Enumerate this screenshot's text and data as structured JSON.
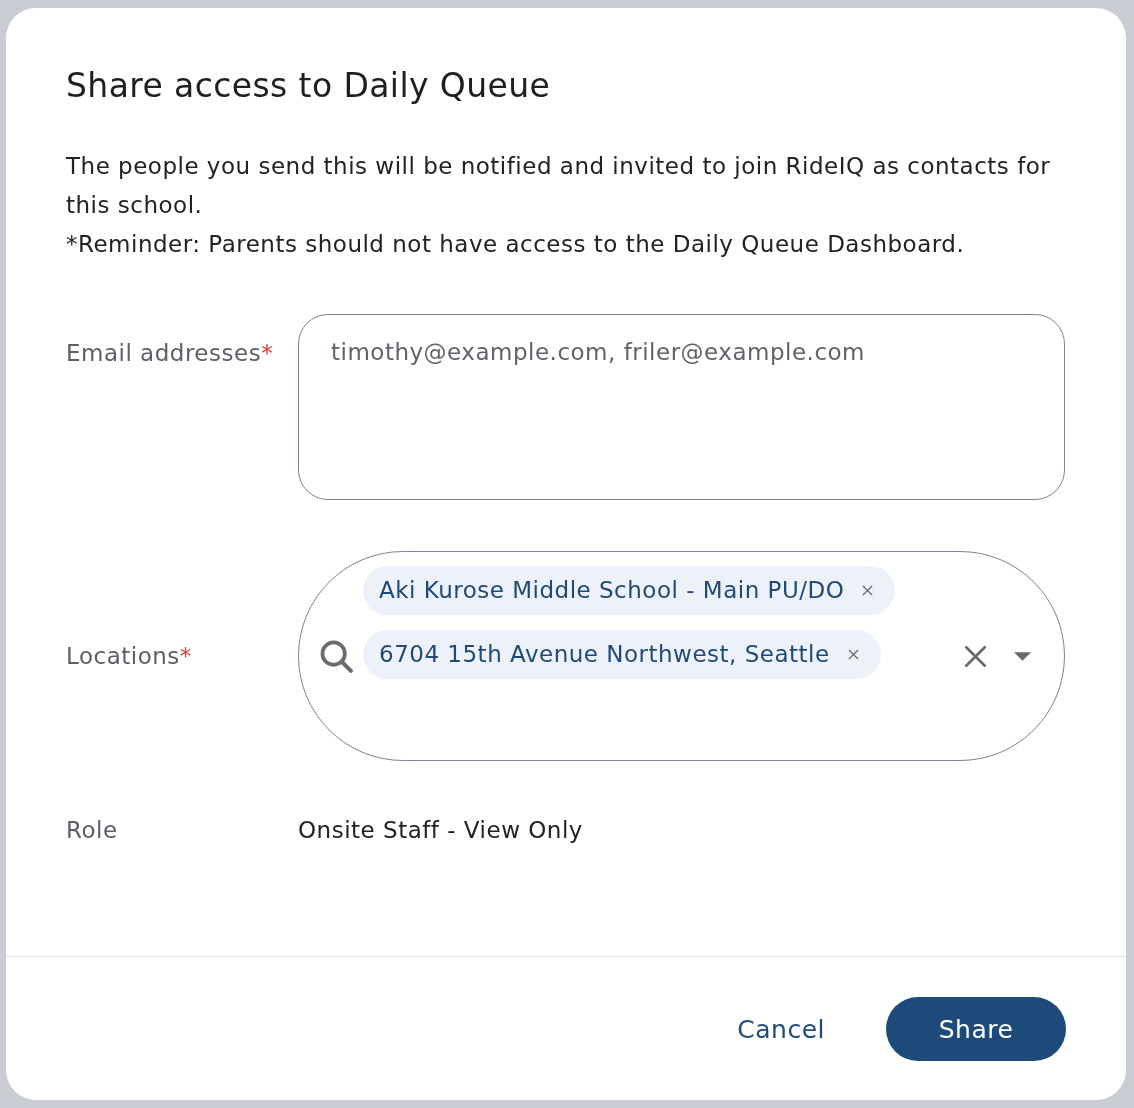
{
  "dialog": {
    "title": "Share access to Daily Queue",
    "description": [
      "The people you send this will be notified and invited to join RideIQ as contacts for this school.",
      "*Reminder: Parents should not have access to the Daily Queue Dashboard."
    ]
  },
  "fields": [
    {
      "kind": "textarea",
      "label": "Email addresses",
      "required_mark": "*",
      "placeholder": "timothy@example.com, friler@example.com"
    },
    {
      "kind": "multiselect",
      "label": "Locations",
      "required_mark": "*",
      "chips": [
        "Aki Kurose Middle School - Main PU/DO",
        "6704 15th Avenue Northwest, Seattle"
      ]
    },
    {
      "kind": "static",
      "label": "Role",
      "value": "Onsite Staff - View Only"
    }
  ],
  "buttons": [
    {
      "kind": "text",
      "label": "Cancel"
    },
    {
      "kind": "primary",
      "label": "Share"
    }
  ]
}
